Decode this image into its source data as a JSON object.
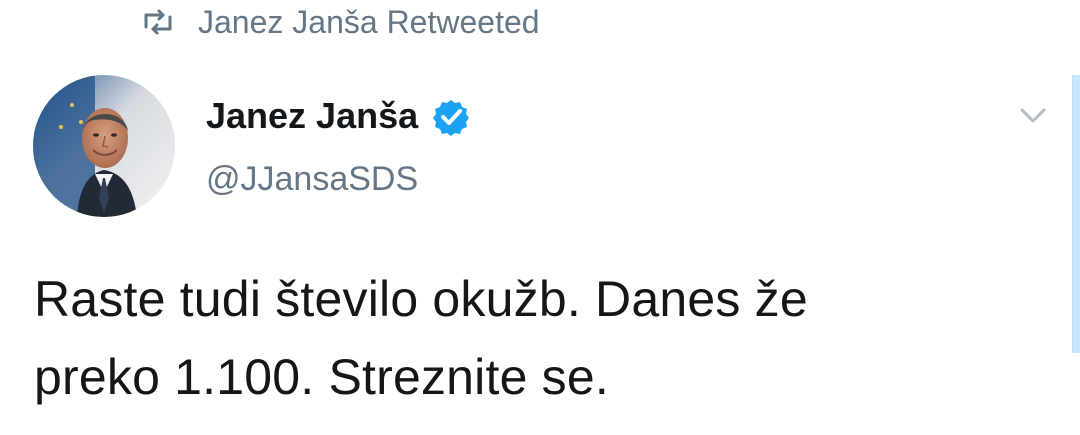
{
  "retweet": {
    "label": "Janez Janša Retweeted",
    "icon": "retweet-icon"
  },
  "author": {
    "display_name": "Janez Janša",
    "handle": "@JJansaSDS",
    "avatar_icon": "profile-photo",
    "verified_icon": "verified-badge-icon"
  },
  "actions": {
    "menu_icon": "chevron-down-icon"
  },
  "tweet": {
    "text": "Raste tudi število okužb. Danes že\npreko 1.100. Streznite se."
  },
  "colors": {
    "text_primary": "#14171a",
    "text_secondary": "#657786",
    "verified_blue": "#1da1f2",
    "scrollbar": "#c9e7fb"
  }
}
